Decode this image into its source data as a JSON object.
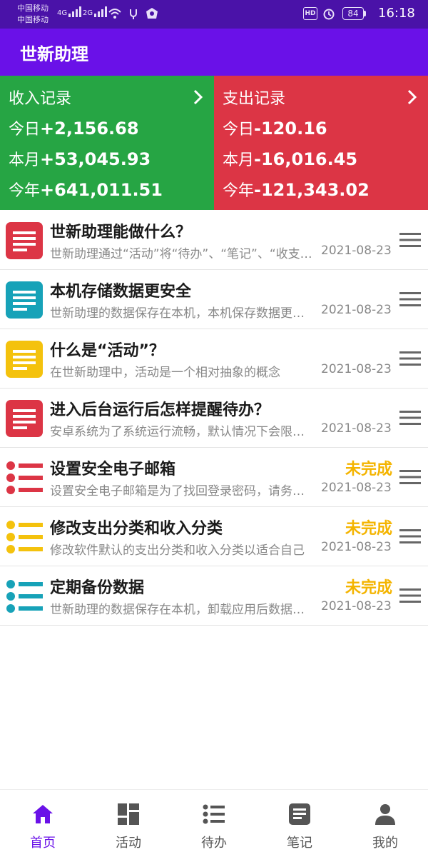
{
  "status_bar": {
    "carrier1": "中国移动",
    "carrier2": "中国移动",
    "net1": "4G",
    "net2": "2G",
    "hd": "HD",
    "battery": "84",
    "time": "16:18"
  },
  "app_bar": {
    "title": "世新助理"
  },
  "income": {
    "title": "收入记录",
    "today_label": "今日",
    "today_value": "+2,156.68",
    "month_label": "本月",
    "month_value": "+53,045.93",
    "year_label": "今年",
    "year_value": "+641,011.51"
  },
  "expense": {
    "title": "支出记录",
    "today_label": "今日",
    "today_value": "-120.16",
    "month_label": "本月",
    "month_value": "-16,016.45",
    "year_label": "今年",
    "year_value": "-121,343.02"
  },
  "items": [
    {
      "title": "世新助理能做什么？",
      "subtitle": "世新助理通过“活动”将“待办”、“笔记”、“收支”等功能关联起来",
      "date": "2021-08-23",
      "status": "",
      "icon": "note-icon",
      "color": "#dc3545"
    },
    {
      "title": "本机存储数据更安全",
      "subtitle": "世新助理的数据保存在本机，本机保存数据更加安全",
      "date": "2021-08-23",
      "status": "",
      "icon": "note-icon",
      "color": "#17a2b8"
    },
    {
      "title": "什么是“活动”？",
      "subtitle": "在世新助理中，活动是一个相对抽象的概念",
      "date": "2021-08-23",
      "status": "",
      "icon": "note-icon",
      "color": "#f4c20d"
    },
    {
      "title": "进入后台运行后怎样提醒待办？",
      "subtitle": "安卓系统为了系统运行流畅，默认情况下会限制后台运行",
      "date": "2021-08-23",
      "status": "",
      "icon": "note-icon",
      "color": "#dc3545"
    },
    {
      "title": "设置安全电子邮箱",
      "subtitle": "设置安全电子邮箱是为了找回登录密码，请务必设置",
      "date": "2021-08-23",
      "status": "未完成",
      "icon": "todo-list-icon",
      "color": "#dc3545"
    },
    {
      "title": "修改支出分类和收入分类",
      "subtitle": "修改软件默认的支出分类和收入分类以适合自己",
      "date": "2021-08-23",
      "status": "未完成",
      "icon": "todo-list-icon",
      "color": "#f4c20d"
    },
    {
      "title": "定期备份数据",
      "subtitle": "世新助理的数据保存在本机，卸载应用后数据将丢失",
      "date": "2021-08-23",
      "status": "未完成",
      "icon": "todo-list-icon",
      "color": "#17a2b8"
    }
  ],
  "nav": [
    {
      "label": "首页",
      "icon": "home-icon",
      "active": true
    },
    {
      "label": "活动",
      "icon": "dashboard-icon",
      "active": false
    },
    {
      "label": "待办",
      "icon": "list-icon",
      "active": false
    },
    {
      "label": "笔记",
      "icon": "notes-icon",
      "active": false
    },
    {
      "label": "我的",
      "icon": "person-icon",
      "active": false
    }
  ],
  "colors": {
    "primary": "#6a11e8",
    "status_bar": "#4a12a8",
    "income": "#26a544",
    "expense": "#dc3545",
    "pending": "#f4b400"
  }
}
